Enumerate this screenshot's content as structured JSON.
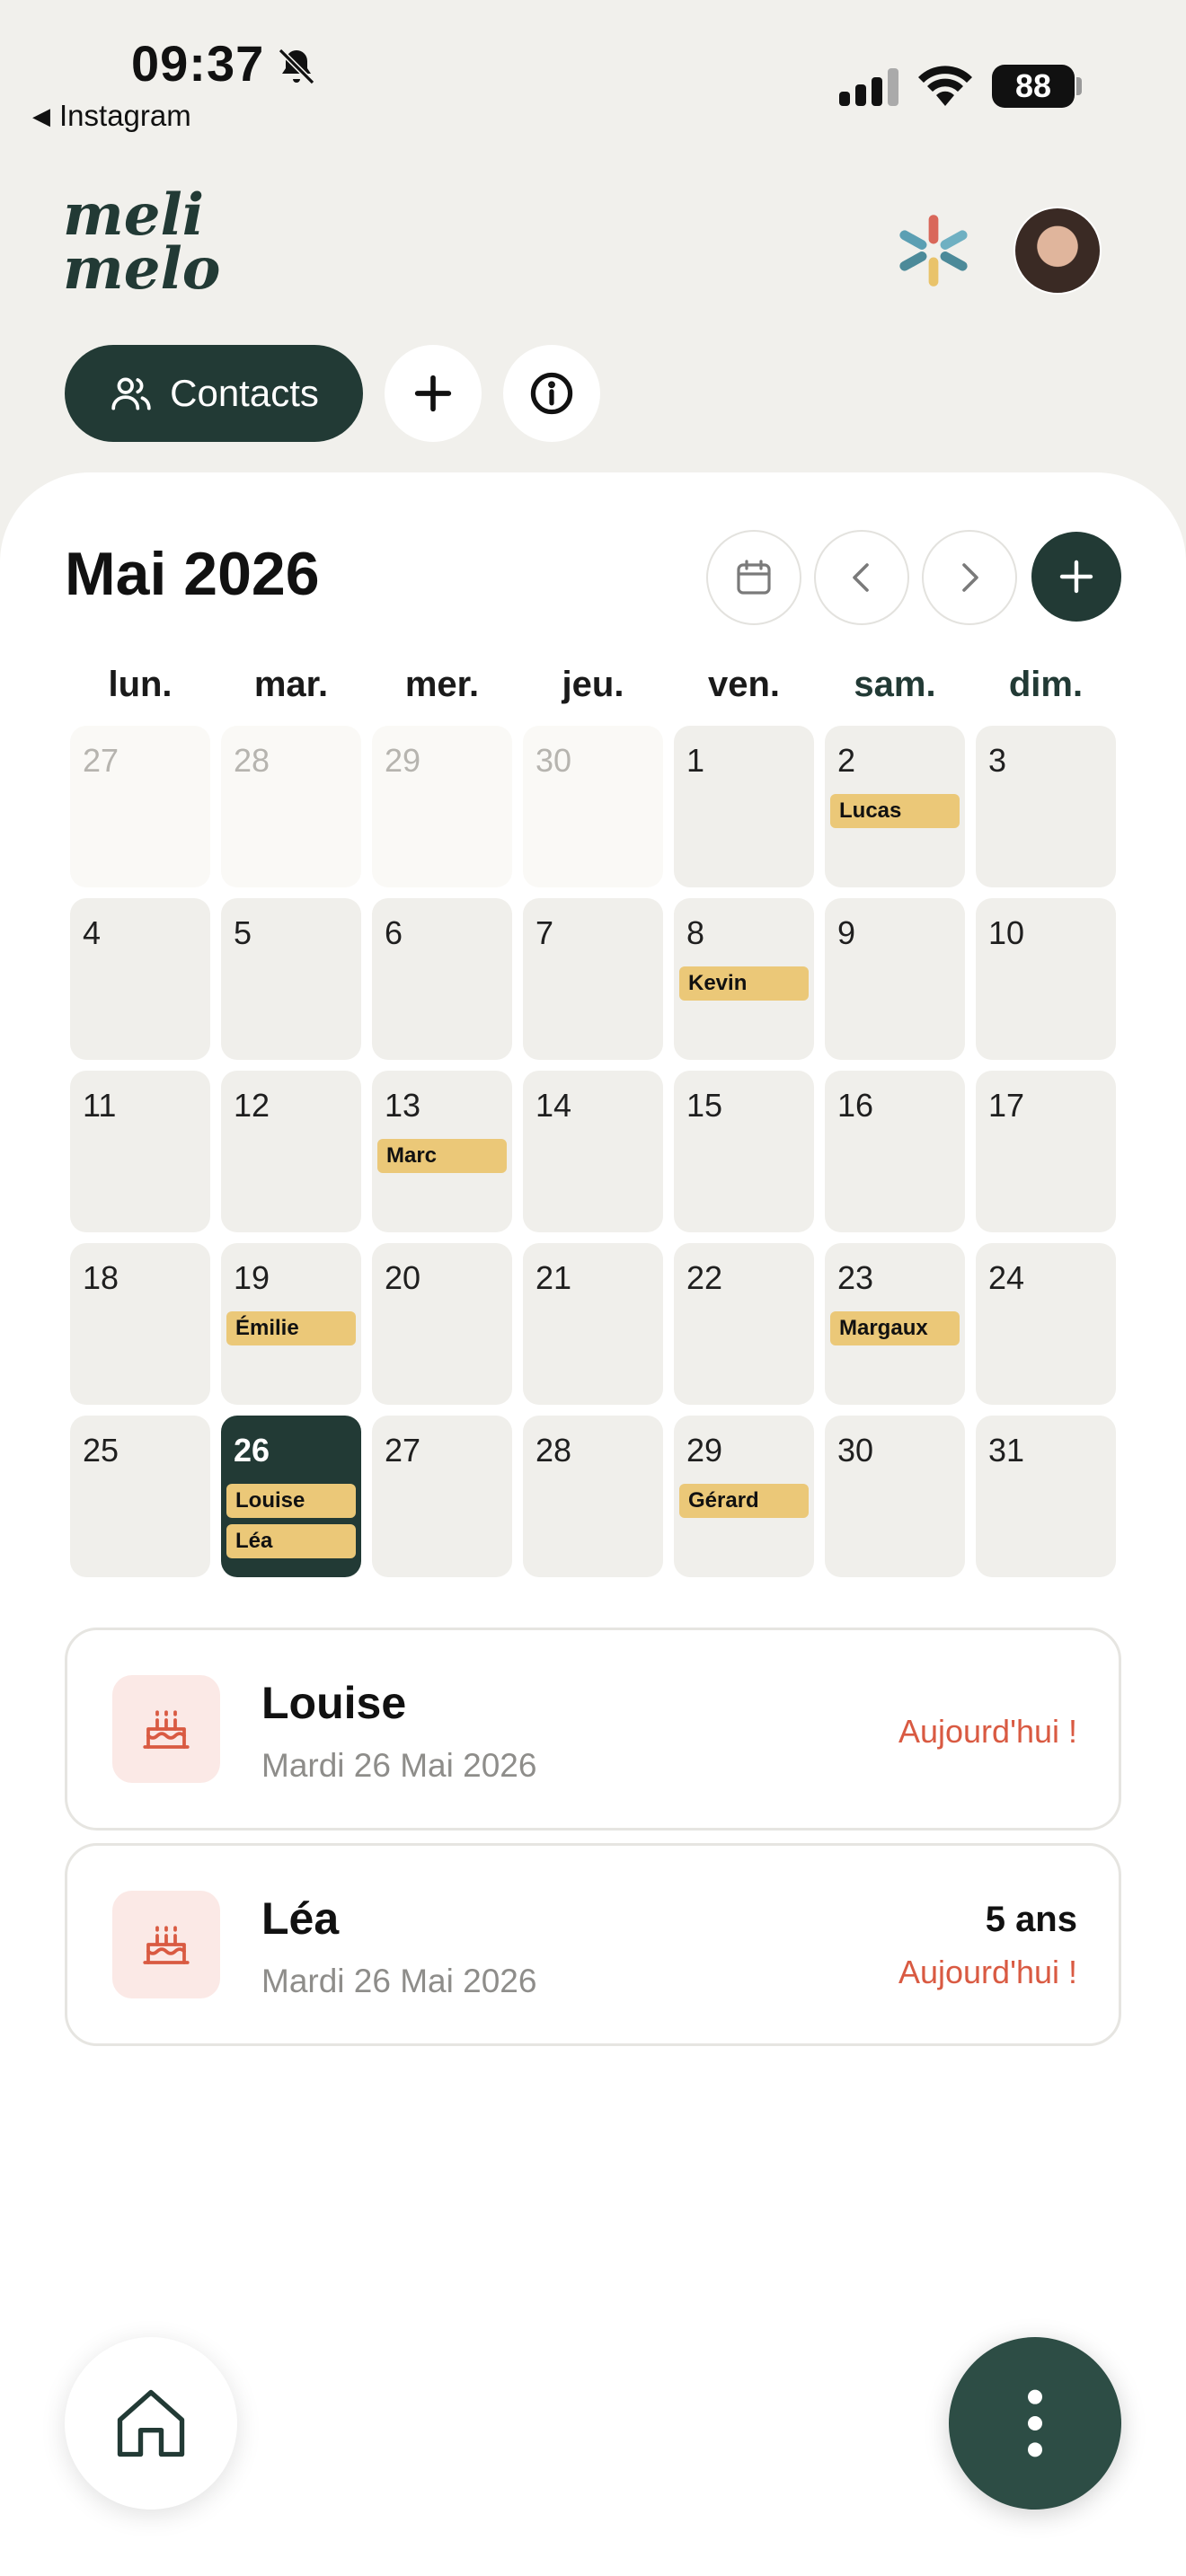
{
  "status_bar": {
    "time": "09:37",
    "back_app": "Instagram",
    "battery": "88"
  },
  "header": {
    "logo_text_line1": "meli",
    "logo_text_line2": "melo",
    "contacts_label": "Contacts"
  },
  "calendar": {
    "month_title": "Mai 2026",
    "weekdays": [
      "lun.",
      "mar.",
      "mer.",
      "jeu.",
      "ven.",
      "sam.",
      "dim."
    ],
    "weeks": [
      [
        {
          "day": "27",
          "other": true,
          "events": []
        },
        {
          "day": "28",
          "other": true,
          "events": []
        },
        {
          "day": "29",
          "other": true,
          "events": []
        },
        {
          "day": "30",
          "other": true,
          "events": []
        },
        {
          "day": "1",
          "events": []
        },
        {
          "day": "2",
          "events": [
            "Lucas"
          ]
        },
        {
          "day": "3",
          "events": []
        }
      ],
      [
        {
          "day": "4",
          "events": []
        },
        {
          "day": "5",
          "events": []
        },
        {
          "day": "6",
          "events": []
        },
        {
          "day": "7",
          "events": []
        },
        {
          "day": "8",
          "events": [
            "Kevin"
          ]
        },
        {
          "day": "9",
          "events": []
        },
        {
          "day": "10",
          "events": []
        }
      ],
      [
        {
          "day": "11",
          "events": []
        },
        {
          "day": "12",
          "events": []
        },
        {
          "day": "13",
          "events": [
            "Marc"
          ]
        },
        {
          "day": "14",
          "events": []
        },
        {
          "day": "15",
          "events": []
        },
        {
          "day": "16",
          "events": []
        },
        {
          "day": "17",
          "events": []
        }
      ],
      [
        {
          "day": "18",
          "events": []
        },
        {
          "day": "19",
          "events": [
            "Émilie"
          ]
        },
        {
          "day": "20",
          "events": []
        },
        {
          "day": "21",
          "events": []
        },
        {
          "day": "22",
          "events": []
        },
        {
          "day": "23",
          "events": [
            "Margaux"
          ]
        },
        {
          "day": "24",
          "events": []
        }
      ],
      [
        {
          "day": "25",
          "events": []
        },
        {
          "day": "26",
          "today": true,
          "events": [
            "Louise",
            "Léa"
          ]
        },
        {
          "day": "27",
          "events": []
        },
        {
          "day": "28",
          "events": []
        },
        {
          "day": "29",
          "events": [
            "Gérard"
          ]
        },
        {
          "day": "30",
          "events": []
        },
        {
          "day": "31",
          "events": []
        }
      ]
    ]
  },
  "birthdays": [
    {
      "name": "Louise",
      "date": "Mardi 26 Mai 2026",
      "age": "",
      "status": "Aujourd'hui !"
    },
    {
      "name": "Léa",
      "date": "Mardi 26 Mai 2026",
      "age": "5 ans",
      "status": "Aujourd'hui !"
    }
  ],
  "colors": {
    "primary": "#223a35",
    "event": "#ebc878",
    "accent_red": "#d95a42",
    "background": "#f1f0ec"
  },
  "icons": {
    "bell": "bell-slash-icon",
    "contacts": "users-icon",
    "add": "plus-icon",
    "info": "info-icon",
    "calendar": "calendar-icon",
    "prev": "chevron-left-icon",
    "next": "chevron-right-icon",
    "birthday": "cake-icon",
    "home": "home-icon",
    "menu": "more-vertical-icon"
  }
}
